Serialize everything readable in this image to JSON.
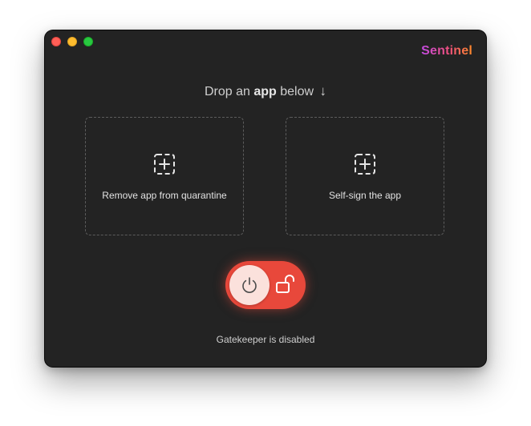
{
  "app": {
    "brand": "Sentinel"
  },
  "window_controls": [
    "close",
    "minimize",
    "zoom"
  ],
  "header": {
    "prefix": "Drop an",
    "emphasis": "app",
    "suffix": "below",
    "arrow": "↓"
  },
  "dropzones": [
    {
      "label": "Remove app from quarantine",
      "icon": "add-square-icon"
    },
    {
      "label": "Self-sign the app",
      "icon": "add-square-icon"
    }
  ],
  "gatekeeper": {
    "toggle_on": true,
    "icons": [
      "power-icon",
      "unlock-icon"
    ],
    "status": "Gatekeeper is disabled"
  },
  "colors": {
    "window_bg": "#232323",
    "toggle_bg": "#e8483b",
    "knob_bg": "#fbe1dc",
    "brand_gradient": [
      "#c34be6",
      "#ee4f7a",
      "#ff8a2a"
    ]
  }
}
